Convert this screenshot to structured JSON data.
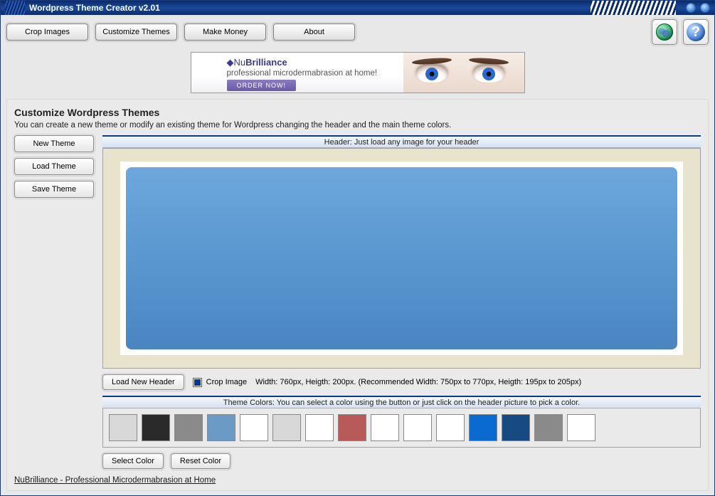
{
  "window": {
    "title": "Wordpress Theme Creator v2.01"
  },
  "menu": {
    "crop": "Crop Images",
    "customize": "Customize Themes",
    "money": "Make Money",
    "about": "About"
  },
  "banner": {
    "logo_prefix": "Nu",
    "logo_bold": "Brilliance",
    "tagline": "professional microdermabrasion at home!",
    "cta": "ORDER NOW!"
  },
  "section": {
    "title": "Customize Wordpress Themes",
    "subtitle": "You can create a new theme or modify an existing theme for Wordpress changing the header and the main theme colors."
  },
  "side": {
    "new_theme": "New Theme",
    "load_theme": "Load Theme",
    "save_theme": "Save Theme"
  },
  "header_area": {
    "label": "Header: Just load any image for your header",
    "load_btn": "Load New Header",
    "crop_chk": "Crop Image",
    "dims": "Width: 760px, Heigth: 200px. (Recommended Width: 750px to 770px, Heigth: 195px to 205px)"
  },
  "colors_area": {
    "label": "Theme Colors: You can select a color using the button or just click on the header picture to pick a color.",
    "select_btn": "Select Color",
    "reset_btn": "Reset Color",
    "swatches": [
      "#d8d8d8",
      "#2a2a2a",
      "#8a8a8a",
      "#6b9ac5",
      "#ffffff",
      "#d8d8d8",
      "#ffffff",
      "#b85a5a",
      "#ffffff",
      "#ffffff",
      "#ffffff",
      "#0a6ad0",
      "#164a80",
      "#8a8a8a",
      "#ffffff"
    ]
  },
  "footer": {
    "link": "NuBrilliance - Professional Microdermabrasion at Home"
  }
}
